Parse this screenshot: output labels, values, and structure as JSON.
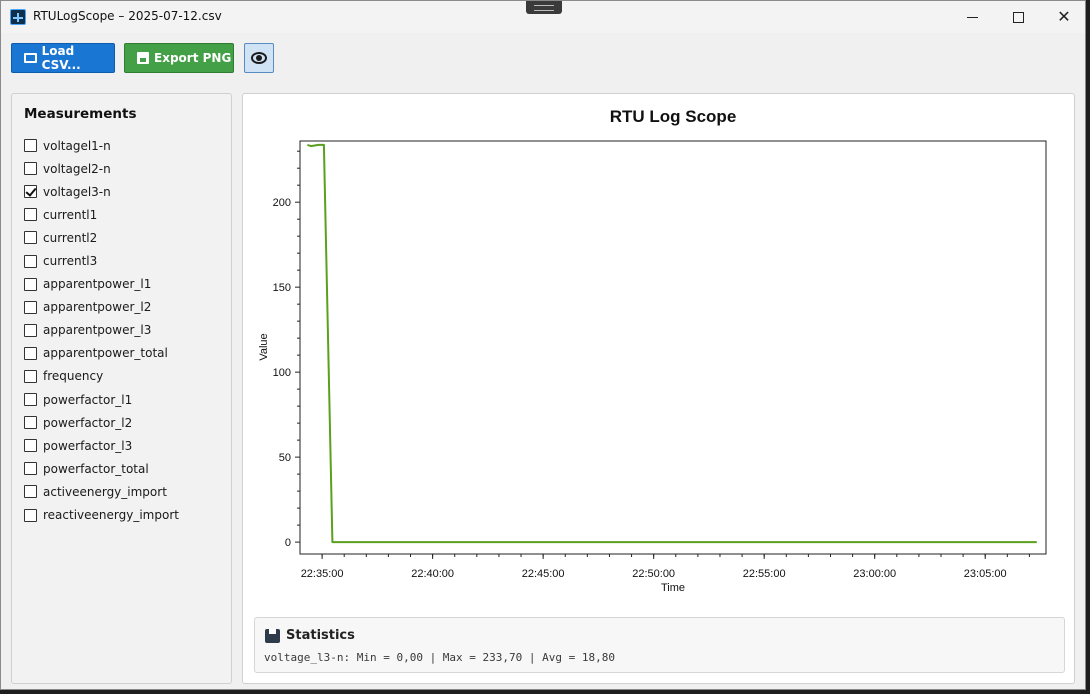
{
  "window": {
    "title": "RTULogScope – 2025-07-12.csv",
    "controls": {
      "minimize": "minimize",
      "maximize": "maximize",
      "close": "✕"
    }
  },
  "toolbar": {
    "load_label": "Load CSV...",
    "export_label": "Export PNG"
  },
  "sidebar": {
    "title": "Measurements",
    "items": [
      {
        "label": "voltagel1-n",
        "checked": false
      },
      {
        "label": "voltagel2-n",
        "checked": false
      },
      {
        "label": "voltagel3-n",
        "checked": true
      },
      {
        "label": "currentl1",
        "checked": false
      },
      {
        "label": "currentl2",
        "checked": false
      },
      {
        "label": "currentl3",
        "checked": false
      },
      {
        "label": "apparentpower_l1",
        "checked": false
      },
      {
        "label": "apparentpower_l2",
        "checked": false
      },
      {
        "label": "apparentpower_l3",
        "checked": false
      },
      {
        "label": "apparentpower_total",
        "checked": false
      },
      {
        "label": "frequency",
        "checked": false
      },
      {
        "label": "powerfactor_l1",
        "checked": false
      },
      {
        "label": "powerfactor_l2",
        "checked": false
      },
      {
        "label": "powerfactor_l3",
        "checked": false
      },
      {
        "label": "powerfactor_total",
        "checked": false
      },
      {
        "label": "activeenergy_import",
        "checked": false
      },
      {
        "label": "reactiveenergy_import",
        "checked": false
      }
    ]
  },
  "chart_data": {
    "type": "line",
    "title": "RTU Log Scope",
    "xlabel": "Time",
    "ylabel": "Value",
    "xlim": [
      "22:34:00",
      "23:07:45"
    ],
    "ylim": [
      -7,
      236
    ],
    "x_ticks": [
      "22:35:00",
      "22:40:00",
      "22:45:00",
      "22:50:00",
      "22:55:00",
      "23:00:00",
      "23:05:00"
    ],
    "y_ticks": [
      0,
      50,
      100,
      150,
      200
    ],
    "grid": false,
    "line_color": "#5aa01e",
    "series": [
      {
        "x": [
          "22:34:20",
          "22:34:30",
          "22:34:50",
          "22:35:05",
          "22:35:28",
          "22:36:00",
          "23:07:20"
        ],
        "y": [
          233.7,
          233.0,
          233.7,
          233.7,
          0.0,
          0.0,
          0.0
        ]
      }
    ]
  },
  "statistics": {
    "title": "Statistics",
    "summary": "voltage_l3-n: Min = 0,00 | Max = 233,70 | Avg = 18,80"
  }
}
